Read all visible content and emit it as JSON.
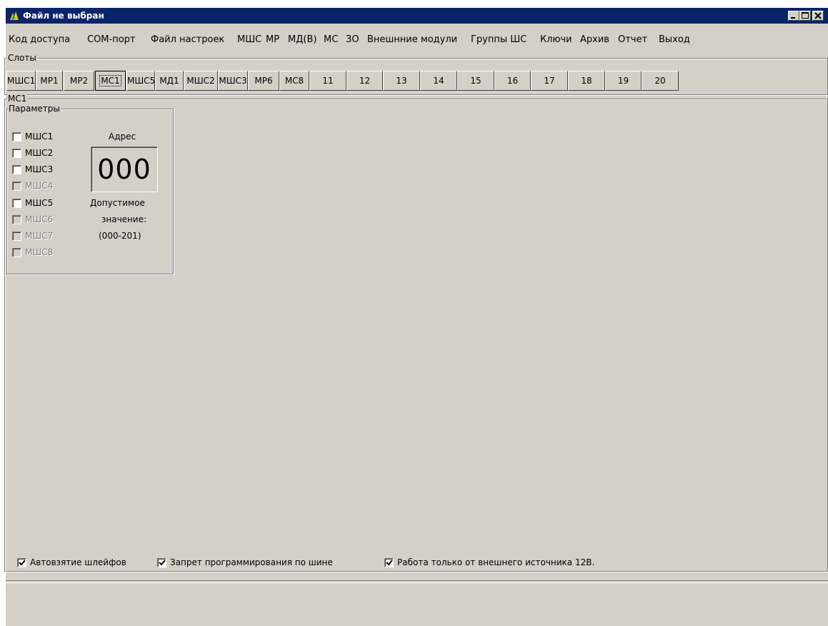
{
  "window": {
    "title": "Файл не выбран",
    "icon": "app-icon"
  },
  "menu": [
    "Код доступа",
    "СОМ-порт",
    "Файл настроек",
    "МШС",
    "МР",
    "МД(В)",
    "МС",
    "ЗО",
    "Внешнние модули",
    "Группы ШС",
    "Ключи",
    "Архив",
    "Отчет",
    "Выход"
  ],
  "slots": {
    "caption": "Слоты",
    "buttons": [
      "МШС1",
      "МР1",
      "МР2",
      "МС1",
      "МШС5",
      "МД1",
      "МШС2",
      "МШС3",
      "МР6",
      "МС8",
      "11",
      "12",
      "13",
      "14",
      "15",
      "16",
      "17",
      "18",
      "19",
      "20"
    ],
    "active": "МС1"
  },
  "module": {
    "caption": "МС1",
    "params_caption": "Параметры",
    "checkboxes": [
      {
        "label": "МШС1",
        "checked": false,
        "enabled": true
      },
      {
        "label": "МШС2",
        "checked": false,
        "enabled": true
      },
      {
        "label": "МШС3",
        "checked": false,
        "enabled": true
      },
      {
        "label": "МШС4",
        "checked": false,
        "enabled": false
      },
      {
        "label": "МШС5",
        "checked": false,
        "enabled": true
      },
      {
        "label": "МШС6",
        "checked": false,
        "enabled": false
      },
      {
        "label": "МШС7",
        "checked": false,
        "enabled": false
      },
      {
        "label": "МШС8",
        "checked": false,
        "enabled": false
      }
    ],
    "address_label": "Адрес",
    "address_value": "000",
    "allowed_line1": "Допустимое",
    "allowed_line2": "значение:",
    "allowed_range": "(000-201)"
  },
  "options": [
    {
      "label": "Автовзятие шлейфов",
      "checked": true
    },
    {
      "label": "Запрет программирования по шине",
      "checked": true
    },
    {
      "label": "Работа только от внешнего источника 12В.",
      "checked": true
    }
  ],
  "colors": {
    "titlebar": "#0a246a",
    "face": "#d4d0c8"
  }
}
